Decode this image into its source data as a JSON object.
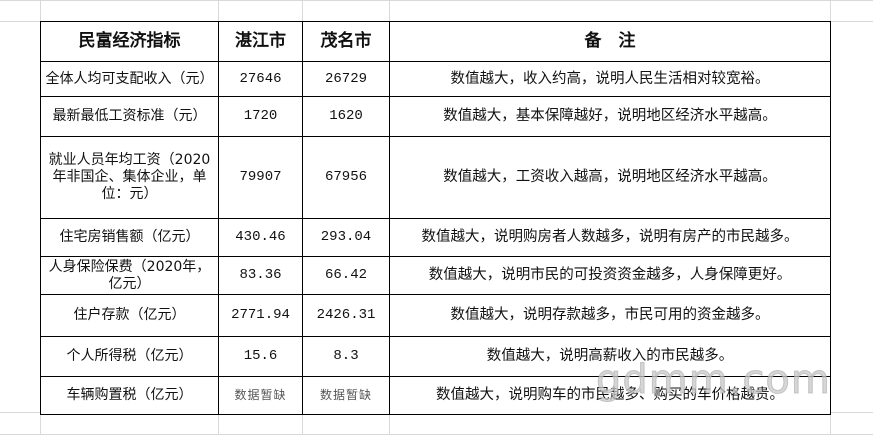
{
  "table": {
    "headers": [
      "民富经济指标",
      "湛江市",
      "茂名市",
      "备　注"
    ],
    "rows": [
      {
        "indicator": "全体人均可支配收入（元）",
        "zhanjiang": "27646",
        "maoming": "26729",
        "note": "数值越大，收入约高，说明人民生活相对较宽裕。"
      },
      {
        "indicator": "最新最低工资标准（元）",
        "zhanjiang": "1720",
        "maoming": "1620",
        "note": "数值越大，基本保障越好，说明地区经济水平越高。"
      },
      {
        "indicator": "就业人员年均工资（2020年非国企、集体企业，单位：元）",
        "zhanjiang": "79907",
        "maoming": "67956",
        "note": "数值越大，工资收入越高，说明地区经济水平越高。"
      },
      {
        "indicator": "住宅房销售额（亿元）",
        "zhanjiang": "430.46",
        "maoming": "293.04",
        "note": "数值越大，说明购房者人数越多，说明有房产的市民越多。"
      },
      {
        "indicator": "人身保险保费（2020年，亿元）",
        "zhanjiang": "83.36",
        "maoming": "66.42",
        "note": "数值越大，说明市民的可投资资金越多，人身保障更好。"
      },
      {
        "indicator": "住户存款（亿元）",
        "zhanjiang": "2771.94",
        "maoming": "2426.31",
        "note": "数值越大，说明存款越多，市民可用的资金越多。"
      },
      {
        "indicator": "个人所得税（亿元）",
        "zhanjiang": "15.6",
        "maoming": "8.3",
        "note": "数值越大，说明高薪收入的市民越多。"
      },
      {
        "indicator": "车辆购置税（亿元）",
        "zhanjiang": "数据暂缺",
        "maoming": "数据暂缺",
        "note": "数值越大，说明购车的市民越多、购买的车价格越贵。"
      }
    ]
  },
  "watermark": "gdmm.com"
}
